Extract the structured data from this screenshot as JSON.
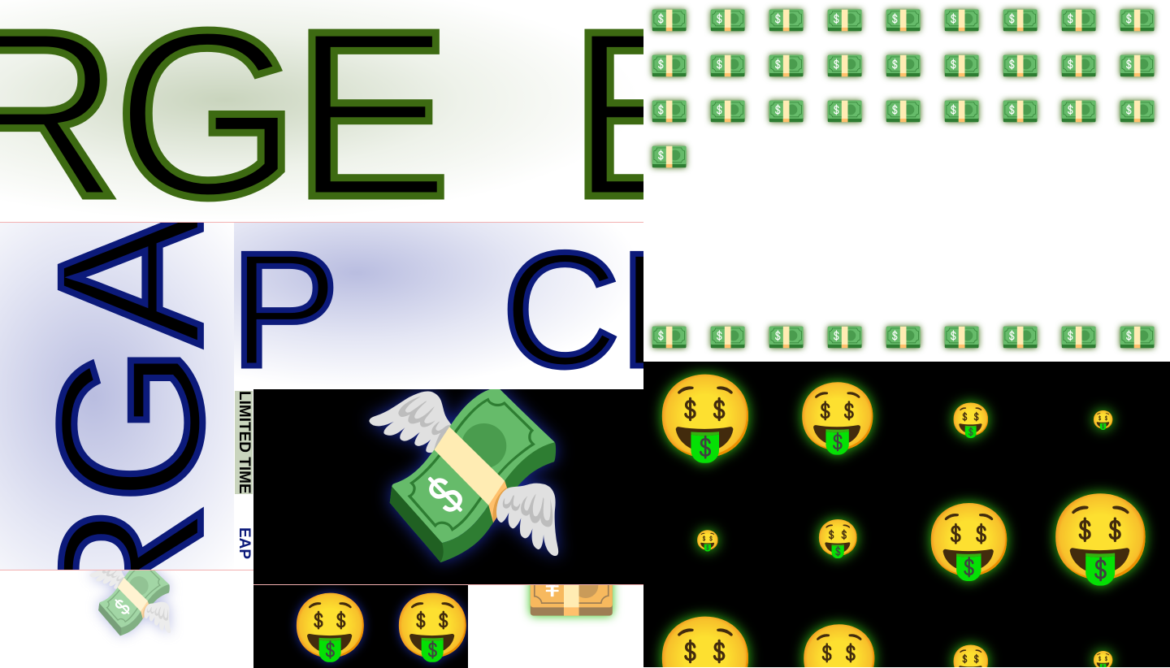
{
  "panels": {
    "green_words": {
      "words": [
        "RGE",
        "E"
      ]
    },
    "blue_vertical": {
      "word": "RGA"
    },
    "blue_words": {
      "words": [
        "P",
        "CL"
      ]
    },
    "side_strip": {
      "line1": "LIMITED TIME",
      "line2": "EAP"
    }
  },
  "icons": {
    "cash_row_1": [
      "💵",
      "💵",
      "💵",
      "💵",
      "💵",
      "💵",
      "💵",
      "💵",
      "💵"
    ],
    "cash_row_2": [
      "💵",
      "💵",
      "💵",
      "💵",
      "💵",
      "💵",
      "💵",
      "💵",
      "💵"
    ],
    "cash_row_3": [
      "💵",
      "💵",
      "💵",
      "💵",
      "💵",
      "💵",
      "💵",
      "💵",
      "💵"
    ],
    "cash_row_4": [
      "💵"
    ],
    "cash_row_5": [
      "💵",
      "💵",
      "💵",
      "💵",
      "💵",
      "💵",
      "💵",
      "💵",
      "💵"
    ],
    "flying_money": "💸",
    "money_face": "🤑",
    "yen": "💴",
    "stack": "💸"
  },
  "colors": {
    "green_outline": "#3d6a12",
    "blue_outline": "#0c1a7a",
    "glow_green": "#36c51a",
    "black": "#000000"
  }
}
